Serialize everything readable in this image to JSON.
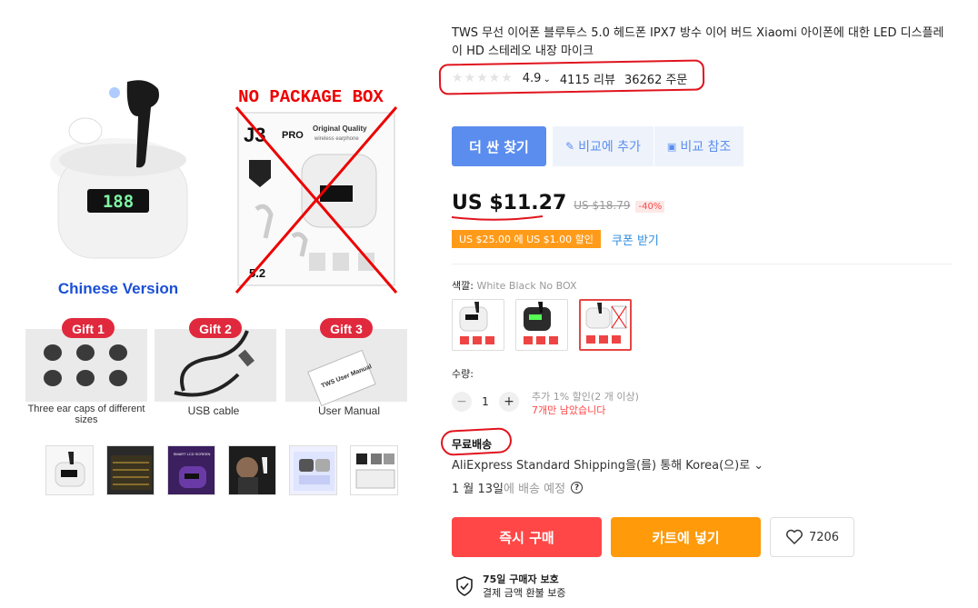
{
  "gallery": {
    "image_labels": {
      "no_package": "NO PACKAGE BOX",
      "chinese_version": "Chinese Version",
      "j3pro": "J3",
      "j3pro_sub": "PRO",
      "original_quality": "Original Quality",
      "wireless": "wireless earphone",
      "size_label": "5.2",
      "case_display": "188",
      "gift1": "Gift 1",
      "gift2": "Gift 2",
      "gift3": "Gift 3",
      "gift1_desc": "Three ear caps of different sizes",
      "gift2_desc": "USB cable",
      "gift3_desc": "User Manual",
      "manual_card": "TWS User Manual",
      "thumb_screen": "SMART LCD SCREEN"
    },
    "thumbnails": [
      "thumb-1",
      "thumb-2",
      "thumb-3",
      "thumb-4",
      "thumb-5",
      "thumb-6"
    ]
  },
  "product": {
    "title": "TWS 무선 이어폰 블루투스 5.0 헤드폰 IPX7 방수 이어 버드 Xiaomi 아이폰에 대한 LED 디스플레이 HD 스테레오 내장 마이크",
    "stars": "★★★★★",
    "rating": "4.9",
    "rating_caret": "⌄",
    "reviews": "4115 리뷰",
    "orders": "36262 주문"
  },
  "buttons": {
    "find_cheaper": "더 싼 찾기",
    "add_compare": "비교에 추가",
    "compare_ref": "비교 참조"
  },
  "price": {
    "current": "US $11.27",
    "original": "US $18.79",
    "discount": "-40%"
  },
  "coupon": {
    "label": "US $25.00 에 US $1.00 할인",
    "get": "쿠폰 받기"
  },
  "color": {
    "label": "색깔:",
    "selected": "White Black No BOX"
  },
  "quantity": {
    "label": "수량:",
    "minus": "−",
    "value": "1",
    "plus": "+",
    "note": "추가 1% 할인(2 개 이상)",
    "left": "7개만 남았습니다"
  },
  "shipping": {
    "title": "무료배송",
    "method": "AliExpress Standard Shipping을(를) 통해 Korea(으)로 ⌄",
    "date_bold": "1 월 13일",
    "date_rest": "에 배송 예정",
    "help": "?"
  },
  "actions": {
    "buy_now": "즉시 구매",
    "add_cart": "카트에 넣기",
    "wishlist_count": "7206"
  },
  "protection": {
    "title": "75일 구매자 보호",
    "subtitle": "결제 금액 환불 보증"
  },
  "colors": {
    "accent_blue": "#5b8def",
    "price_red": "#ff4747",
    "coupon_orange": "#ff9b19",
    "annotation_red": "#e0141e"
  }
}
